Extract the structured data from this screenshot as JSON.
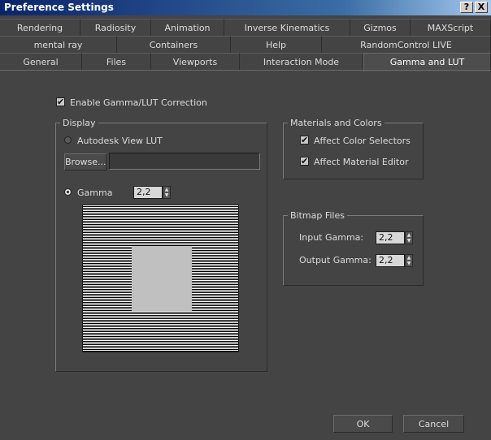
{
  "window": {
    "title": "Preference Settings",
    "help_btn": "?",
    "close_btn": "X"
  },
  "tabs": {
    "row1": [
      "Rendering",
      "Radiosity",
      "Animation",
      "Inverse Kinematics",
      "Gizmos",
      "MAXScript"
    ],
    "row2": [
      "mental ray",
      "Containers",
      "Help",
      "RandomControl LIVE"
    ],
    "row3": [
      "General",
      "Files",
      "Viewports",
      "Interaction Mode",
      "Gamma and LUT"
    ],
    "active": "Gamma and LUT"
  },
  "enable_gamma": {
    "label": "Enable Gamma/LUT Correction",
    "checked": true
  },
  "display": {
    "legend": "Display",
    "view_lut_label": "Autodesk View LUT",
    "browse_label": "Browse...",
    "lut_path": "",
    "gamma_label": "Gamma",
    "gamma_value": "2,2",
    "selected": "gamma"
  },
  "materials": {
    "legend": "Materials and Colors",
    "affect_color_selectors": "Affect Color Selectors",
    "affect_material_editor": "Affect Material Editor"
  },
  "bitmap": {
    "legend": "Bitmap Files",
    "input_label": "Input Gamma:",
    "input_value": "2,2",
    "output_label": "Output Gamma:",
    "output_value": "2,2"
  },
  "footer": {
    "ok_label": "OK",
    "cancel_label": "Cancel"
  },
  "icons": {
    "check": "✔",
    "spin_up": "▲",
    "spin_down": "▼"
  }
}
